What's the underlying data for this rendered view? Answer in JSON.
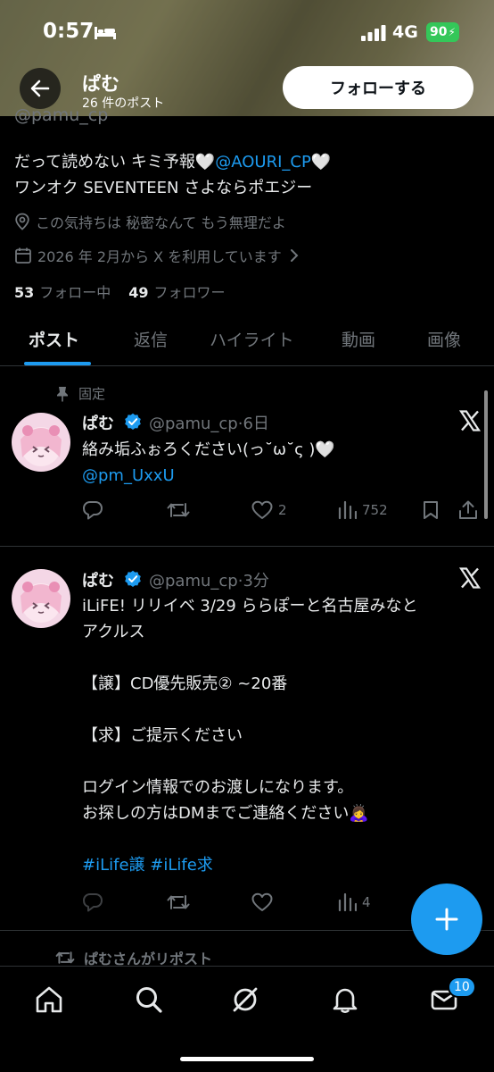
{
  "status_bar": {
    "time": "0:57",
    "network": "4G",
    "battery": "90",
    "bed_icon": "bed-icon",
    "signal_icon": "signal-bars-icon"
  },
  "header": {
    "name": "ぱむ",
    "post_count": "26 件のポスト",
    "follow_label": "フォローする",
    "back_icon": "arrow-left-icon"
  },
  "profile": {
    "handle": "@pamu_cp",
    "bio_line1_prefix": "だって読めない キミ予報🤍",
    "bio_mention": "@AOURI_CP",
    "bio_line1_suffix": "🤍",
    "bio_line2": "ワンオク SEVENTEEN さよならポエジー",
    "location": "この気持ちは 秘密なんて もう無理だよ",
    "joined": "2026 年 2月から X を利用しています",
    "following_count": "53",
    "following_label": "フォロー中",
    "followers_count": "49",
    "followers_label": "フォロワー"
  },
  "tabs": [
    {
      "label": "ポスト",
      "active": true
    },
    {
      "label": "返信",
      "active": false
    },
    {
      "label": "ハイライト",
      "active": false
    },
    {
      "label": "動画",
      "active": false
    },
    {
      "label": "画像",
      "active": false
    }
  ],
  "pinned_label": "固定",
  "posts": [
    {
      "name": "ぱむ",
      "handle": "@pamu_cp",
      "time": "6日",
      "text_line1": "絡み垢ふぉろください(っ˘ω˘ς )🤍",
      "text_mention": "@pm_UxxU",
      "likes": "2",
      "views": "752"
    },
    {
      "name": "ぱむ",
      "handle": "@pamu_cp",
      "time": "3分",
      "text_lines": [
        "iLiFE! リリイベ 3/29 ららぽーと名古屋みなと",
        "アクルス",
        "",
        "【譲】CD優先販売② ~20番",
        "",
        "【求】ご提示ください",
        "",
        "ログイン情報でのお渡しになります。",
        "お探しの方はDMまでご連絡ください🙇‍♀️",
        ""
      ],
      "hashtags": "#iLife譲 #iLife求",
      "views": "4"
    }
  ],
  "repost_label": "ぱむさんがリポスト",
  "bottom_nav": {
    "messages_badge": "10"
  },
  "colors": {
    "accent": "#1d9bf0",
    "background": "#000000",
    "muted": "#71767b",
    "text": "#e7e9ea",
    "verified": "#1d9bf0"
  }
}
